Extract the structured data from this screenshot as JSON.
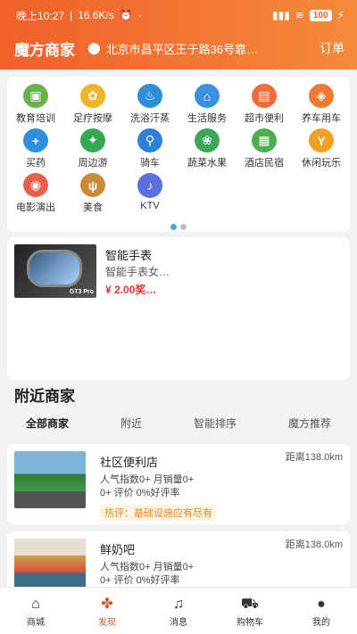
{
  "status": {
    "time": "晚上10:27",
    "speed": "16.6K/s",
    "battery": "100"
  },
  "header": {
    "title": "魔方商家",
    "address": "北京市昌平区王于路36号靠…",
    "order": "订单"
  },
  "categories": [
    {
      "label": "教育培训",
      "color": "#6ab04c",
      "icon": "book-icon",
      "glyph": "▣"
    },
    {
      "label": "足疗按摩",
      "color": "#f0b429",
      "icon": "foot-icon",
      "glyph": "✿"
    },
    {
      "label": "洗浴汗蒸",
      "color": "#2d8fd5",
      "icon": "bath-icon",
      "glyph": "♨"
    },
    {
      "label": "生活服务",
      "color": "#3b8fe0",
      "icon": "home-icon",
      "glyph": "⌂"
    },
    {
      "label": "超市便利",
      "color": "#f06a3a",
      "icon": "basket-icon",
      "glyph": "▤"
    },
    {
      "label": "养车用车",
      "color": "#f07a32",
      "icon": "car-icon",
      "glyph": "◈"
    },
    {
      "label": "买药",
      "color": "#2f8fdc",
      "icon": "medkit-icon",
      "glyph": "+"
    },
    {
      "label": "周边游",
      "color": "#34a853",
      "icon": "island-icon",
      "glyph": "✦"
    },
    {
      "label": "骑车",
      "color": "#2f80d8",
      "icon": "bike-icon",
      "glyph": "⚲"
    },
    {
      "label": "蔬菜水果",
      "color": "#3fa55a",
      "icon": "fruit-icon",
      "glyph": "❀"
    },
    {
      "label": "酒店民宿",
      "color": "#4cae4f",
      "icon": "hotel-icon",
      "glyph": "▦"
    },
    {
      "label": "休闲玩乐",
      "color": "#f2a024",
      "icon": "cocktail-icon",
      "glyph": "Y"
    },
    {
      "label": "电影演出",
      "color": "#e8604c",
      "icon": "film-icon",
      "glyph": "◉"
    },
    {
      "label": "美食",
      "color": "#c98a3a",
      "icon": "cutlery-icon",
      "glyph": "ψ"
    },
    {
      "label": "KTV",
      "color": "#5b6fe0",
      "icon": "microphone-icon",
      "glyph": "♪"
    }
  ],
  "product": {
    "name": "智能手表",
    "desc": "智能手表女…",
    "price": "¥ 2.00奖…",
    "badge": "GT3 Pro"
  },
  "section_title": "附近商家",
  "tabs": [
    "全部商家",
    "附近",
    "智能排序",
    "魔方推荐"
  ],
  "merchants": [
    {
      "name": "社区便利店",
      "distance": "距离138.0km",
      "line1": "人气指数0+  月销量0+",
      "line2": "0+ 评价  0%好评率",
      "tag": "热评：基础设施应有尽有"
    },
    {
      "name": "鲜奶吧",
      "distance": "距离138.0km",
      "line1": "人气指数0+  月销量0+",
      "line2": "0+ 评价  0%好评率"
    }
  ],
  "tabbar": [
    {
      "label": "商城",
      "icon": "home-icon",
      "glyph": "⌂"
    },
    {
      "label": "发现",
      "icon": "discover-icon",
      "glyph": "✤"
    },
    {
      "label": "消息",
      "icon": "bell-icon",
      "glyph": "♫"
    },
    {
      "label": "购物车",
      "icon": "cart-icon",
      "glyph": "⛟"
    },
    {
      "label": "我的",
      "icon": "user-icon",
      "glyph": "●"
    }
  ],
  "active_tab": "发现"
}
